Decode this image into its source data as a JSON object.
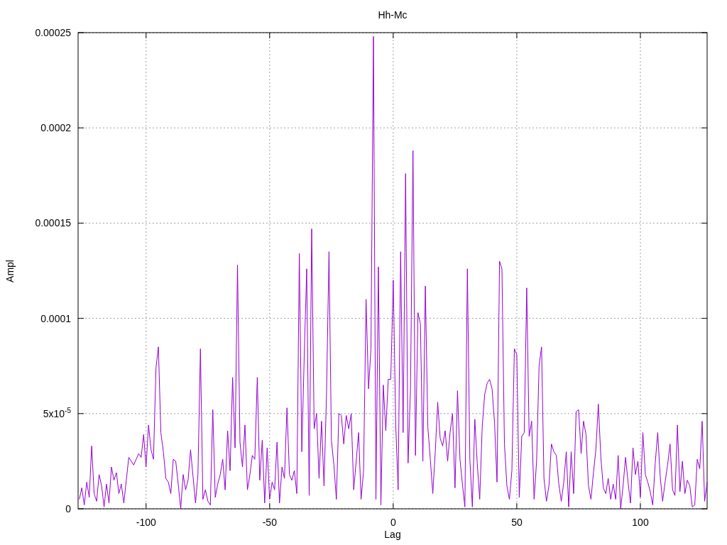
{
  "chart_data": {
    "type": "line",
    "grid": true,
    "title": "Hh-Mc",
    "xlabel": "Lag",
    "ylabel": "Ampl",
    "xlim": [
      -127.5,
      127
    ],
    "ylim": [
      0,
      0.00025
    ],
    "xticks": [
      -100,
      -50,
      0,
      50,
      100
    ],
    "yticks": [
      {
        "value": 0,
        "label": "0"
      },
      {
        "value": 5e-05,
        "label": "5x10$^{-5}$"
      },
      {
        "value": 0.0001,
        "label": "0.0001"
      },
      {
        "value": 0.00015,
        "label": "0.00015"
      },
      {
        "value": 0.0002,
        "label": "0.0002"
      },
      {
        "value": 0.00025,
        "label": "0.00025"
      }
    ],
    "x": [
      -127,
      -126,
      -125,
      -124,
      -123,
      -122,
      -121,
      -120,
      -119,
      -118,
      -117,
      -116,
      -115,
      -114,
      -113,
      -112,
      -111,
      -110,
      -109,
      -108,
      -107,
      -106,
      -105,
      -104,
      -103,
      -102,
      -101,
      -100,
      -99,
      -98,
      -97,
      -96,
      -95,
      -94,
      -93,
      -92,
      -91,
      -90,
      -89,
      -88,
      -87,
      -86,
      -85,
      -84,
      -83,
      -82,
      -81,
      -80,
      -79,
      -78,
      -77,
      -76,
      -75,
      -74,
      -73,
      -72,
      -71,
      -70,
      -69,
      -68,
      -67,
      -66,
      -65,
      -64,
      -63,
      -62,
      -61,
      -60,
      -59,
      -58,
      -57,
      -56,
      -55,
      -54,
      -53,
      -52,
      -51,
      -50,
      -49,
      -48,
      -47,
      -46,
      -45,
      -44,
      -43,
      -42,
      -41,
      -40,
      -39,
      -38,
      -37,
      -36,
      -35,
      -34,
      -33,
      -32,
      -31,
      -30,
      -29,
      -28,
      -27,
      -26,
      -25,
      -24,
      -23,
      -22,
      -21,
      -20,
      -19,
      -18,
      -17,
      -16,
      -15,
      -14,
      -13,
      -12,
      -11,
      -10,
      -9,
      -8,
      -7,
      -6,
      -5,
      -4,
      -3,
      -2,
      -1,
      0,
      1,
      2,
      3,
      4,
      5,
      6,
      7,
      8,
      9,
      10,
      11,
      12,
      13,
      14,
      15,
      16,
      17,
      18,
      19,
      20,
      21,
      22,
      23,
      24,
      25,
      26,
      27,
      28,
      29,
      30,
      31,
      32,
      33,
      34,
      35,
      36,
      37,
      38,
      39,
      40,
      41,
      42,
      43,
      44,
      45,
      46,
      47,
      48,
      49,
      50,
      51,
      52,
      53,
      54,
      55,
      56,
      57,
      58,
      59,
      60,
      61,
      62,
      63,
      64,
      65,
      66,
      67,
      68,
      69,
      70,
      71,
      72,
      73,
      74,
      75,
      76,
      77,
      78,
      79,
      80,
      81,
      82,
      83,
      84,
      85,
      86,
      87,
      88,
      89,
      90,
      91,
      92,
      93,
      94,
      95,
      96,
      97,
      98,
      99,
      100,
      101,
      102,
      103,
      104,
      105,
      106,
      107,
      108,
      109,
      110,
      111,
      112,
      113,
      114,
      115,
      116,
      117,
      118,
      119,
      120,
      121,
      122,
      123,
      124,
      125,
      126,
      127
    ],
    "series": [
      {
        "color": "#9400d3",
        "values": [
          5e-06,
          1.1e-05,
          2e-06,
          1.4e-05,
          6e-06,
          3.3e-05,
          8e-06,
          4e-06,
          1.8e-05,
          1.2e-05,
          1e-06,
          1.3e-05,
          3e-06,
          2.2e-05,
          1.5e-05,
          1.9e-05,
          8e-06,
          1.3e-05,
          3e-06,
          1.5e-05,
          2.7e-05,
          2.5e-05,
          2.3e-05,
          2.6e-05,
          2.9e-05,
          2.7e-05,
          3.9e-05,
          2.2e-05,
          4.4e-05,
          3.1e-05,
          2.6e-05,
          7.4e-05,
          8.5e-05,
          4e-05,
          3e-05,
          1.6e-05,
          1.4e-05,
          8e-06,
          2.6e-05,
          2.5e-05,
          1.3e-05,
          0,
          1.8e-05,
          1e-05,
          1.5e-05,
          3.1e-05,
          1.7e-05,
          3e-06,
          1.8e-05,
          8.4e-05,
          5e-06,
          1e-05,
          4e-06,
          2e-06,
          5.2e-05,
          6e-06,
          1.3e-05,
          1.8e-05,
          2.6e-05,
          1e-05,
          4.1e-05,
          2e-05,
          6.9e-05,
          3.2e-05,
          0.000128,
          3.5e-05,
          2.2e-05,
          4.4e-05,
          1e-05,
          1.8e-05,
          2.8e-05,
          2.6e-05,
          6.9e-05,
          1.5e-05,
          3.6e-05,
          3e-06,
          3.2e-05,
          5e-06,
          1.4e-05,
          1e-05,
          3.5e-05,
          3e-06,
          2.2e-05,
          1.6e-05,
          5.3e-05,
          1.8e-05,
          1.5e-05,
          2e-05,
          8e-06,
          0.000134,
          3e-05,
          8e-05,
          0.000126,
          7e-06,
          0.000147,
          4.2e-05,
          5e-05,
          1.6e-05,
          4.6e-05,
          1.2e-05,
          6e-05,
          0.000135,
          3.6e-05,
          2.3e-05,
          5e-06,
          5e-05,
          4.9e-05,
          3.4e-05,
          4.9e-05,
          4.2e-05,
          5e-05,
          1e-05,
          2.5e-05,
          4e-05,
          5e-06,
          2e-05,
          0.00011,
          6.3e-05,
          8.4e-05,
          0.000248,
          5e-06,
          0.000127,
          2e-06,
          6.5e-05,
          4.1e-05,
          6.8e-05,
          6.8e-05,
          0.00012,
          4.4e-05,
          1e-05,
          0.000135,
          4e-05,
          0.000176,
          2.4e-05,
          6.3e-05,
          0.000188,
          2.8e-05,
          0.000103,
          9.7e-05,
          2.5e-05,
          0.000117,
          4.3e-05,
          2.6e-05,
          8e-06,
          3e-05,
          5.6e-05,
          3.7e-05,
          3.3e-05,
          4.1e-05,
          2.5e-05,
          4e-05,
          5e-05,
          1.1e-05,
          6.2e-05,
          2.6e-05,
          1.3e-05,
          1e-06,
          0.000126,
          2.6e-05,
          1e-06,
          4.7e-05,
          2.4e-05,
          5e-06,
          4.3e-05,
          6e-05,
          6.6e-05,
          6.8e-05,
          6.3e-05,
          4.5e-05,
          1.4e-05,
          0.00013,
          0.000126,
          3.4e-05,
          1.2e-05,
          5e-06,
          2e-05,
          8.4e-05,
          8.1e-05,
          6e-06,
          3.8e-05,
          4e-05,
          0.000116,
          3.8e-05,
          4.6e-05,
          5e-06,
          2.5e-05,
          7.5e-05,
          8.5e-05,
          1.6e-05,
          4e-06,
          1.2e-05,
          3.4e-05,
          3e-05,
          2.8e-05,
          1.3e-05,
          4e-06,
          1.4e-05,
          3e-05,
          1e-06,
          3e-05,
          8e-06,
          5.1e-05,
          5.2e-05,
          2.9e-05,
          4.6e-05,
          3.9e-05,
          1.2e-05,
          5e-06,
          1.9e-05,
          3.1e-05,
          5.5e-05,
          2.7e-05,
          1.1e-05,
          8e-06,
          1.6e-05,
          5e-06,
          1.3e-05,
          5e-06,
          2.8e-05,
          0,
          1.2e-05,
          2.7e-05,
          1.4e-05,
          3e-06,
          3.2e-05,
          1.8e-05,
          2.5e-05,
          6e-06,
          4e-05,
          1.8e-05,
          1.4e-05,
          9e-06,
          2e-06,
          2.4e-05,
          4e-05,
          1.7e-05,
          4e-06,
          1.4e-05,
          2.3e-05,
          3.4e-05,
          1e-05,
          7e-06,
          4.4e-05,
          9e-06,
          2.5e-05,
          8e-06,
          1.5e-05,
          1.2e-05,
          1e-06,
          2e-06,
          2.6e-05,
          2.1e-05,
          4.6e-05,
          4e-06,
          1.4e-05
        ]
      }
    ]
  }
}
